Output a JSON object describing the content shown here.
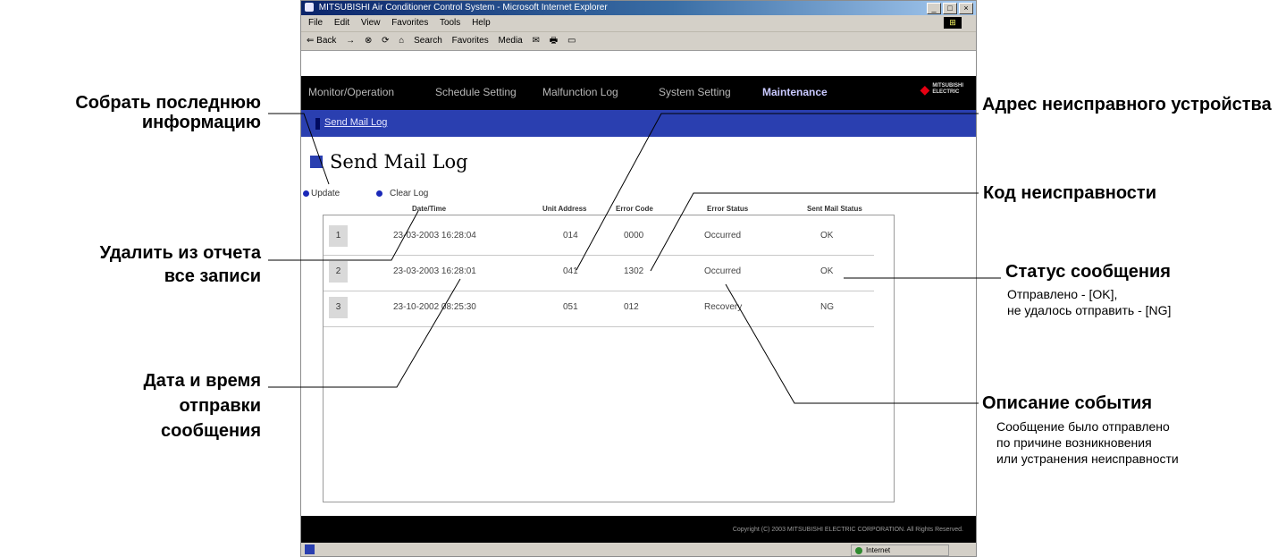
{
  "window": {
    "title": "MITSUBISHI Air Conditioner Control System - Microsoft Internet Explorer",
    "controls": [
      "_",
      "□",
      "×"
    ],
    "menu": [
      "File",
      "Edit",
      "View",
      "Favorites",
      "Tools",
      "Help"
    ],
    "toolbar": [
      "⇐ Back",
      "→",
      "⊗",
      "⟳",
      "⌂",
      "Search",
      "Favorites",
      "Media",
      "✉",
      "🖶",
      "▭"
    ]
  },
  "nav": {
    "items": [
      "Monitor/Operation",
      "Schedule Setting",
      "Malfunction Log",
      "System Setting",
      "Maintenance"
    ],
    "active_index": 4,
    "brand_line1": "MITSUBISHI",
    "brand_line2": "ELECTRIC"
  },
  "subnav": {
    "link": "Send Mail Log"
  },
  "page": {
    "title": "Send Mail Log",
    "update_label": "Update",
    "clear_label": "Clear Log"
  },
  "table": {
    "headers": [
      "Date/Time",
      "Unit Address",
      "Error Code",
      "Error Status",
      "Sent Mail Status"
    ],
    "rows": [
      {
        "num": "1",
        "datetime": "23-03-2003  16:28:04",
        "address": "014",
        "code": "0000",
        "status": "Occurred",
        "mail": "OK"
      },
      {
        "num": "2",
        "datetime": "23-03-2003  16:28:01",
        "address": "041",
        "code": "1302",
        "status": "Occurred",
        "mail": "OK"
      },
      {
        "num": "3",
        "datetime": "23-10-2002  08:25:30",
        "address": "051",
        "code": "012",
        "status": "Recovery",
        "mail": "NG"
      }
    ]
  },
  "footer": {
    "copyright": "Copyright (C) 2003 MITSUBISHI ELECTRIC CORPORATION. All Rights Reserved."
  },
  "status_bar": {
    "zone": "Internet"
  },
  "callouts": {
    "update": "Собрать последнюю информацию",
    "clear": "Удалить из отчета все записи",
    "datetime": "Дата и время отправки сообщения",
    "address": "Адрес неисправного устройства",
    "code": "Код неисправности",
    "mail_status": "Статус сообщения",
    "mail_status_note_1": "Отправлено - [OK],",
    "mail_status_note_2": "не удалось отправить - [NG]",
    "event": "Описание события",
    "event_note_1": "Сообщение было отправлено",
    "event_note_2": "по причине возникновения",
    "event_note_3": "или устранения неисправности"
  }
}
